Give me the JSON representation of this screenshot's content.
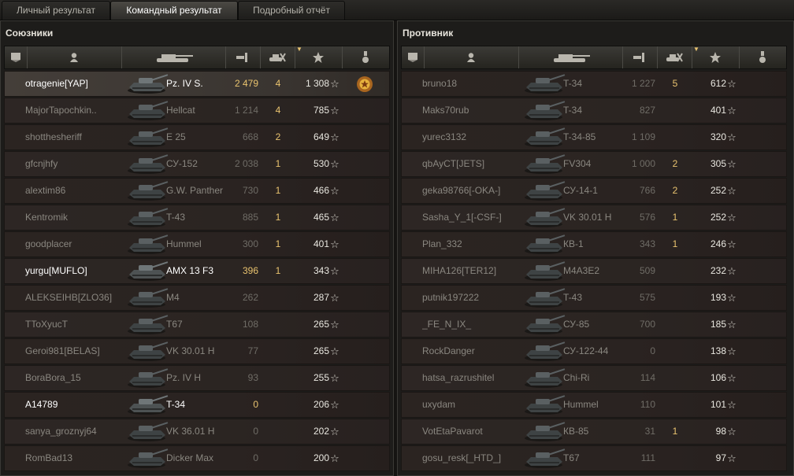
{
  "tabs": [
    {
      "label": "Личный результат",
      "active": false
    },
    {
      "label": "Командный результат",
      "active": true
    },
    {
      "label": "Подробный отчёт",
      "active": false
    }
  ],
  "allies": {
    "title": "Союзники",
    "rows": [
      {
        "player": "otragenie[YAP]",
        "tank": "Pz. IV S.",
        "damage": "2 479",
        "kills": "4",
        "xp": "1 308",
        "medal": true,
        "bright": true
      },
      {
        "player": "MajorTapochkin..",
        "tank": "Hellcat",
        "damage": "1 214",
        "kills": "4",
        "xp": "785"
      },
      {
        "player": "shotthesheriff",
        "tank": "E 25",
        "damage": "668",
        "kills": "2",
        "xp": "649"
      },
      {
        "player": "gfcnjhfy",
        "tank": "СУ-152",
        "damage": "2 038",
        "kills": "1",
        "xp": "530"
      },
      {
        "player": "alextim86",
        "tank": "G.W. Panther",
        "damage": "730",
        "kills": "1",
        "xp": "466"
      },
      {
        "player": "Kentromik",
        "tank": "T-43",
        "damage": "885",
        "kills": "1",
        "xp": "465"
      },
      {
        "player": "goodplacer",
        "tank": "Hummel",
        "damage": "300",
        "kills": "1",
        "xp": "401"
      },
      {
        "player": "yurgu[MUFLO]",
        "tank": "AMX 13 F3",
        "damage": "396",
        "kills": "1",
        "xp": "343",
        "bright": true
      },
      {
        "player": "ALEKSEIHB[ZLO36]",
        "tank": "M4",
        "damage": "262",
        "kills": "",
        "xp": "287"
      },
      {
        "player": "TToXyucT",
        "tank": "T67",
        "damage": "108",
        "kills": "",
        "xp": "265"
      },
      {
        "player": "Geroi981[BELAS]",
        "tank": "VK 30.01 H",
        "damage": "77",
        "kills": "",
        "xp": "265"
      },
      {
        "player": "BoraBora_15",
        "tank": "Pz. IV H",
        "damage": "93",
        "kills": "",
        "xp": "255"
      },
      {
        "player": "A14789",
        "tank": "T-34",
        "damage": "0",
        "kills": "",
        "xp": "206",
        "bright": true
      },
      {
        "player": "sanya_groznyj64",
        "tank": "VK 36.01 H",
        "damage": "0",
        "kills": "",
        "xp": "202"
      },
      {
        "player": "RomBad13",
        "tank": "Dicker Max",
        "damage": "0",
        "kills": "",
        "xp": "200"
      }
    ]
  },
  "enemies": {
    "title": "Противник",
    "rows": [
      {
        "player": "bruno18",
        "tank": "T-34",
        "damage": "1 227",
        "kills": "5",
        "xp": "612"
      },
      {
        "player": "Maks70rub",
        "tank": "T-34",
        "damage": "827",
        "kills": "",
        "xp": "401"
      },
      {
        "player": "yurec3132",
        "tank": "T-34-85",
        "damage": "1 109",
        "kills": "",
        "xp": "320"
      },
      {
        "player": "qbAyCT[JETS]",
        "tank": "FV304",
        "damage": "1 000",
        "kills": "2",
        "xp": "305"
      },
      {
        "player": "geka98766[-OKA-]",
        "tank": "СУ-14-1",
        "damage": "766",
        "kills": "2",
        "xp": "252"
      },
      {
        "player": "Sasha_Y_1[-CSF-]",
        "tank": "VK 30.01 H",
        "damage": "576",
        "kills": "1",
        "xp": "252"
      },
      {
        "player": "Plan_332",
        "tank": "КВ-1",
        "damage": "343",
        "kills": "1",
        "xp": "246"
      },
      {
        "player": "MIHA126[TER12]",
        "tank": "M4A3E2",
        "damage": "509",
        "kills": "",
        "xp": "232"
      },
      {
        "player": "putnik197222",
        "tank": "T-43",
        "damage": "575",
        "kills": "",
        "xp": "193"
      },
      {
        "player": "_FE_N_IX_",
        "tank": "СУ-85",
        "damage": "700",
        "kills": "",
        "xp": "185"
      },
      {
        "player": "RockDanger",
        "tank": "СУ-122-44",
        "damage": "0",
        "kills": "",
        "xp": "138"
      },
      {
        "player": "hatsa_razrushitel",
        "tank": "Chi-Ri",
        "damage": "114",
        "kills": "",
        "xp": "106"
      },
      {
        "player": "uxydam",
        "tank": "Hummel",
        "damage": "110",
        "kills": "",
        "xp": "101"
      },
      {
        "player": "VotEtaPavarot",
        "tank": "КВ-85",
        "damage": "31",
        "kills": "1",
        "xp": "98"
      },
      {
        "player": "gosu_resk[_HTD_]",
        "tank": "T67",
        "damage": "111",
        "kills": "",
        "xp": "97"
      }
    ]
  },
  "star_glyph": "☆",
  "icons": [
    "tier-icon",
    "player-icon",
    "tank-icon",
    "damage-icon",
    "kills-icon",
    "experience-star-icon",
    "medal-icon"
  ]
}
